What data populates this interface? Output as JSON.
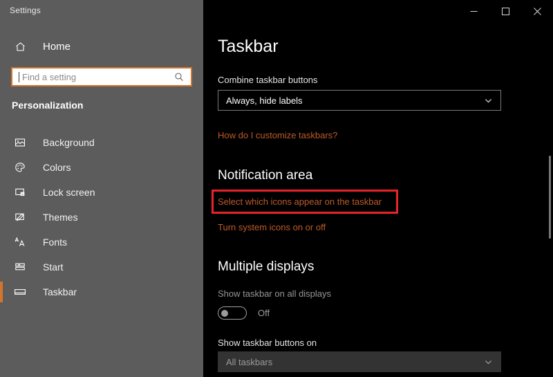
{
  "window": {
    "app_title": "Settings",
    "controls": {
      "minimize": "minimize",
      "maximize": "maximize",
      "close": "close"
    }
  },
  "sidebar": {
    "home": {
      "label": "Home",
      "icon": "home-icon"
    },
    "search": {
      "value": "",
      "placeholder": "Find a setting",
      "icon": "search-icon"
    },
    "section_title": "Personalization",
    "items": [
      {
        "label": "Background",
        "icon": "picture-icon",
        "selected": false
      },
      {
        "label": "Colors",
        "icon": "palette-icon",
        "selected": false
      },
      {
        "label": "Lock screen",
        "icon": "lock-screen-icon",
        "selected": false
      },
      {
        "label": "Themes",
        "icon": "themes-brush-icon",
        "selected": false
      },
      {
        "label": "Fonts",
        "icon": "fonts-aa-icon",
        "selected": false
      },
      {
        "label": "Start",
        "icon": "start-tiles-icon",
        "selected": false
      },
      {
        "label": "Taskbar",
        "icon": "taskbar-icon",
        "selected": true
      }
    ]
  },
  "main": {
    "page_title": "Taskbar",
    "combine_label": "Combine taskbar buttons",
    "combine_value": "Always, hide labels",
    "customize_link": "How do I customize taskbars?",
    "notification_heading": "Notification area",
    "notification_link_1": "Select which icons appear on the taskbar",
    "notification_link_2": "Turn system icons on or off",
    "displays_heading": "Multiple displays",
    "show_taskbar_label": "Show taskbar on all displays",
    "show_taskbar_state": "Off",
    "show_buttons_label": "Show taskbar buttons on",
    "show_buttons_value": "All taskbars"
  },
  "annotation": {
    "highlight_color": "#e8232a",
    "target": "Select which icons appear on the taskbar"
  },
  "colors": {
    "accent": "#d2762f",
    "link": "#c05a2a",
    "sidebar_bg": "#5c5c5c",
    "content_bg": "#000000",
    "highlight": "#e8232a"
  }
}
